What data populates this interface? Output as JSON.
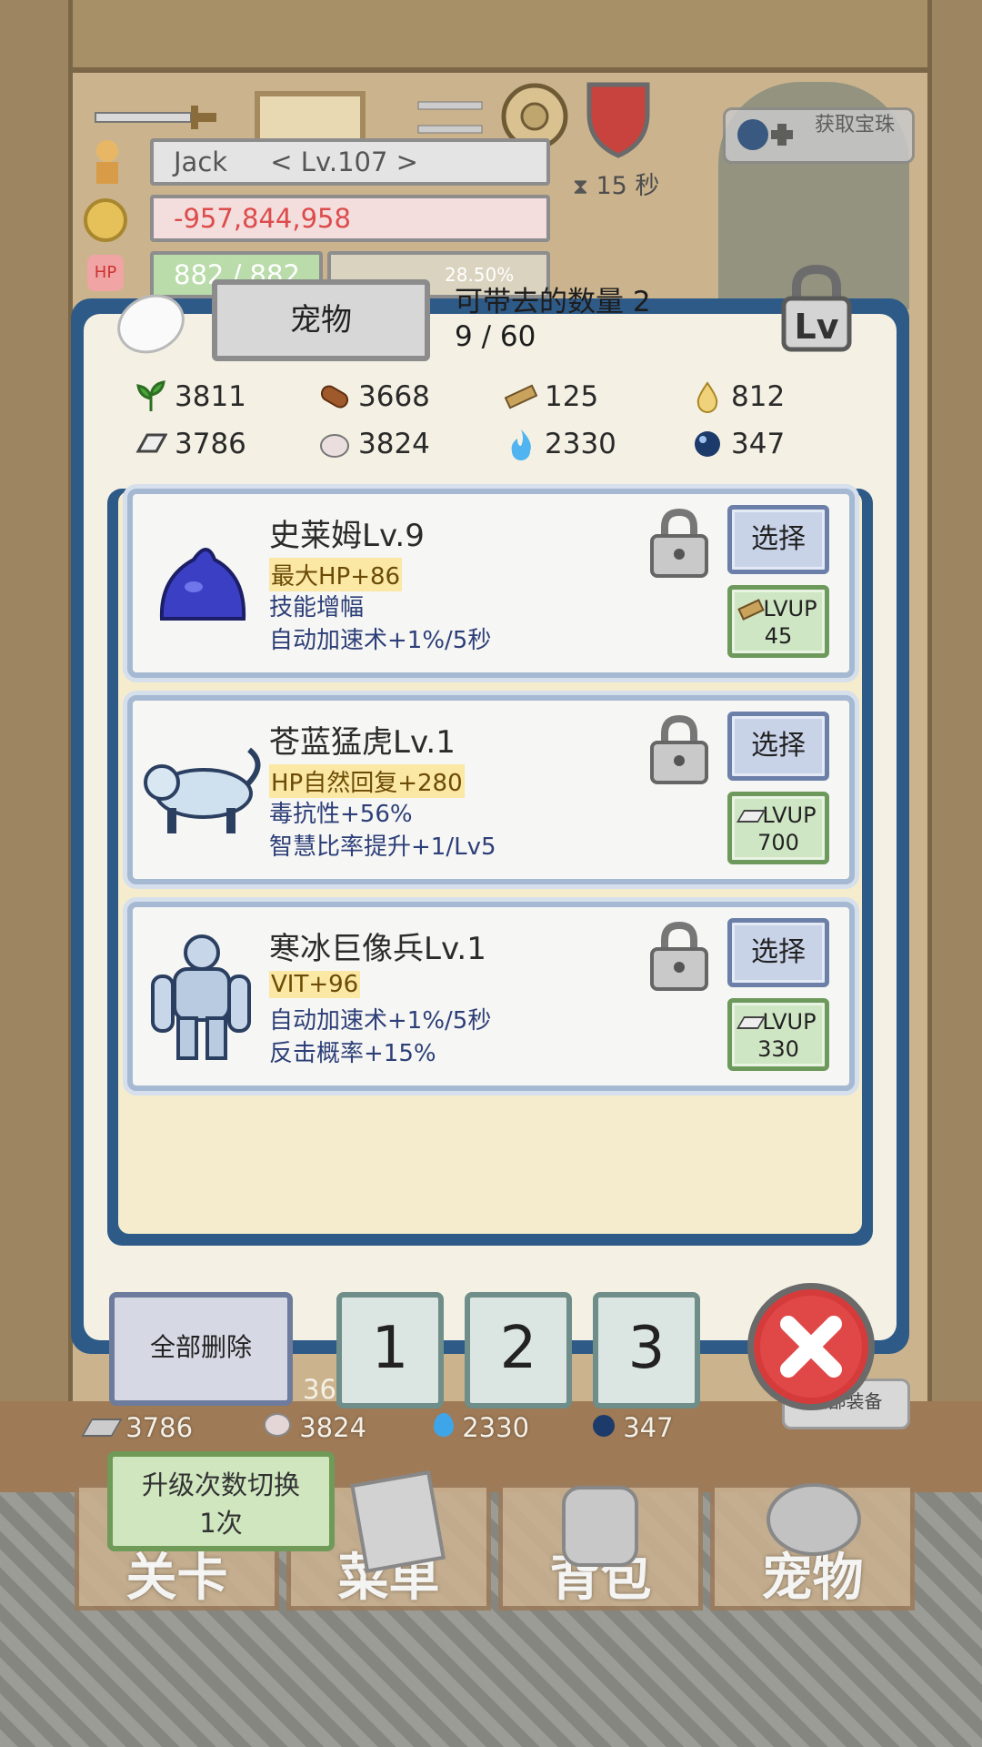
{
  "hud": {
    "player_name": "Jack",
    "player_level": "< Lv.107 >",
    "gold": "-957,844,958",
    "hp": "882 / 882",
    "exp_percent": "28.50%",
    "timer": "15 秒",
    "obtain_button": "获取宝珠"
  },
  "panel": {
    "tab_label": "宠物",
    "carry_caption": "可带去的数量 2",
    "pet_count": "9 / 60",
    "lock_badge": "Lv"
  },
  "resources": [
    {
      "icon": "herb-icon",
      "value": "3811",
      "color": "#3f8f2f"
    },
    {
      "icon": "log-icon",
      "value": "3668",
      "color": "#8a4b22"
    },
    {
      "icon": "plank-icon",
      "value": "125",
      "color": "#b08a4a"
    },
    {
      "icon": "drop-icon",
      "value": "812",
      "color": "#e2b63b"
    },
    {
      "icon": "ingot-icon",
      "value": "3786",
      "color": "#9a9a9a"
    },
    {
      "icon": "stone-icon",
      "value": "3824",
      "color": "#d8c8c8"
    },
    {
      "icon": "blue-flame-icon",
      "value": "2330",
      "color": "#3ea5e8"
    },
    {
      "icon": "orb-icon",
      "value": "347",
      "color": "#1d3b6a"
    }
  ],
  "pets": [
    {
      "name": "史莱姆Lv.9",
      "stat1": "最大HP+86",
      "stat2": "技能增幅",
      "stat3": "自动加速术+1%/5秒",
      "select_label": "选择",
      "lvup_label": "LVUP",
      "lvup_cost": "45",
      "lvup_material_icon": "plank-icon",
      "portrait": "slime-icon"
    },
    {
      "name": "苍蓝猛虎Lv.1",
      "stat1": "HP自然回复+280",
      "stat2": "毒抗性+56%",
      "stat3": "智慧比率提升+1/Lv5",
      "select_label": "选择",
      "lvup_label": "LVUP",
      "lvup_cost": "700",
      "lvup_material_icon": "ingot-icon",
      "portrait": "tiger-icon"
    },
    {
      "name": "寒冰巨像兵Lv.1",
      "stat1": "VIT+96",
      "stat2": "自动加速术+1%/5秒",
      "stat3": "反击概率+15%",
      "select_label": "选择",
      "lvup_label": "LVUP",
      "lvup_cost": "330",
      "lvup_material_icon": "ingot-icon",
      "portrait": "golem-icon"
    }
  ],
  "footer": {
    "delete_all": "全部删除",
    "slots": [
      "1",
      "2",
      "3"
    ]
  },
  "background": {
    "partial_count": "36",
    "res_values": [
      "3786",
      "3824",
      "2330",
      "347"
    ],
    "equip_all": "全部装备",
    "upgrade_toggle_line1": "升级次数切换",
    "upgrade_toggle_line2": "1次",
    "nav": [
      "关卡",
      "菜单",
      "背包",
      "宠物"
    ]
  }
}
